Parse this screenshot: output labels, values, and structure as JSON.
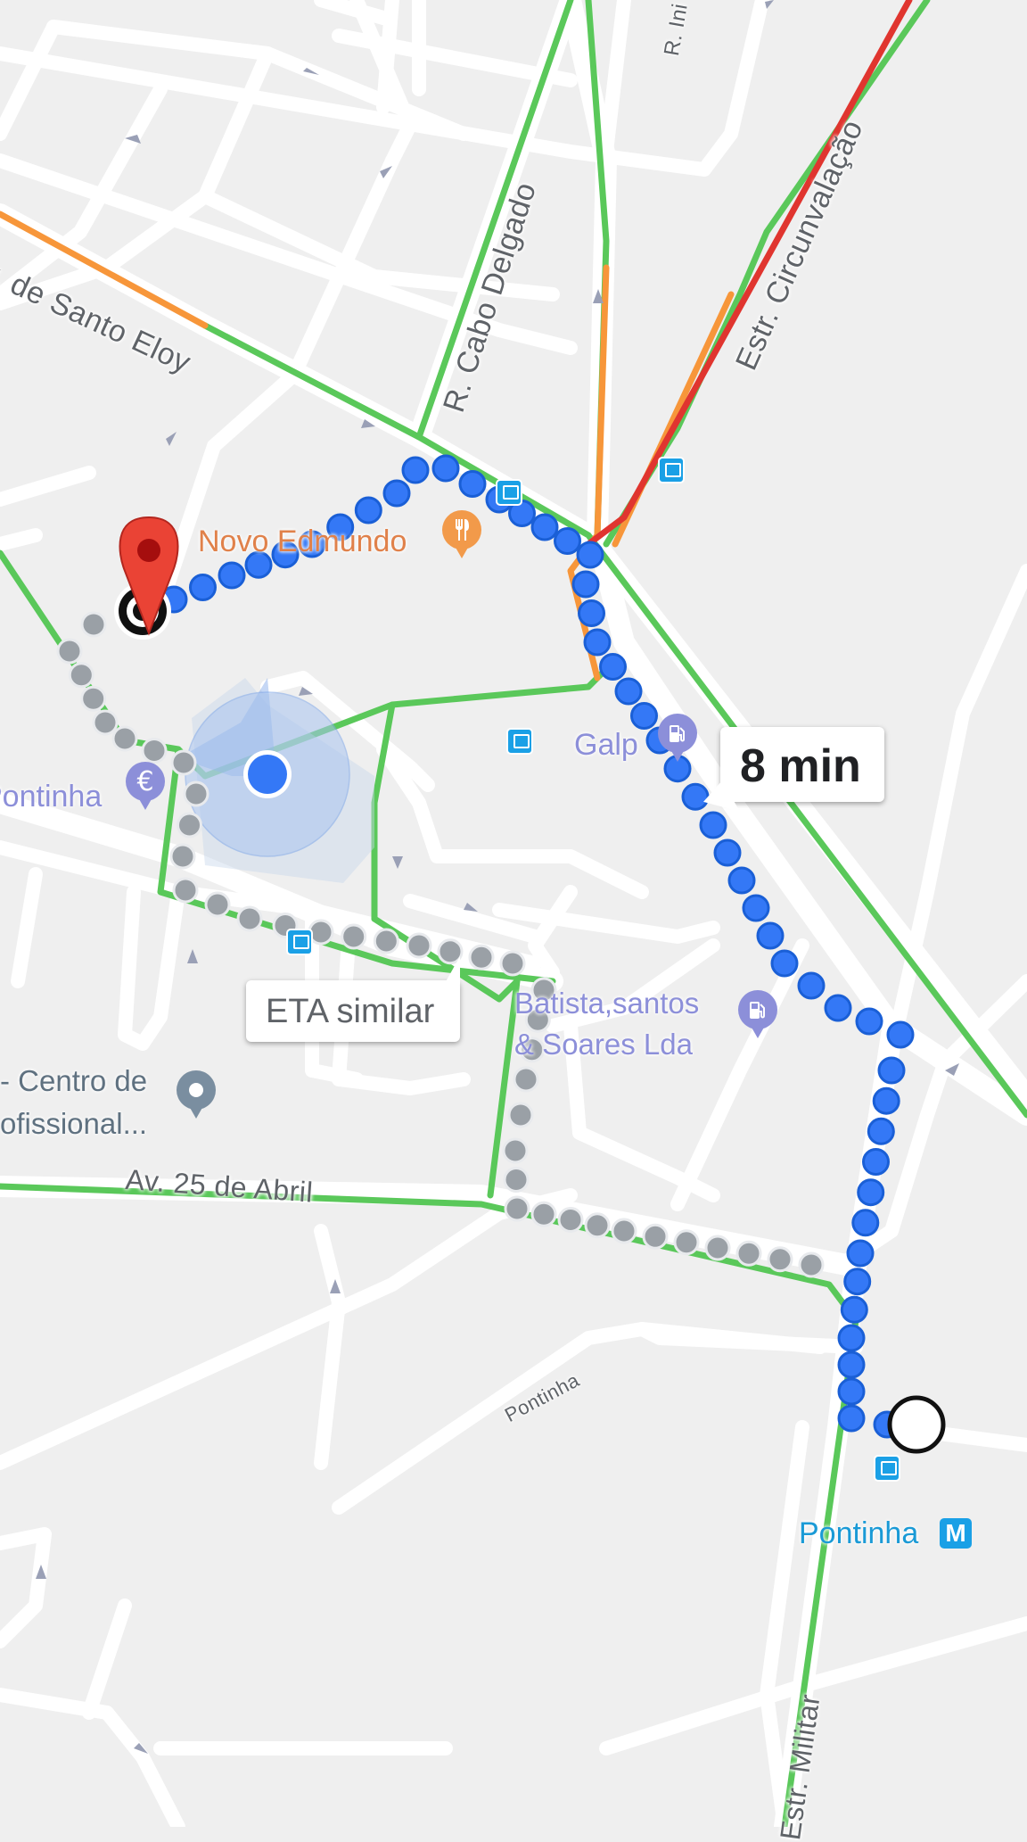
{
  "map": {
    "colors": {
      "background": "#efefef",
      "road": "#ffffff",
      "traffic_green": "#5ac85a",
      "traffic_orange": "#f7963a",
      "traffic_red": "#e0352f",
      "route_primary": "#3478f6",
      "route_alternative": "#9aa0a6",
      "food_poi": "#f29a4a",
      "service_poi": "#8c8fd9",
      "place_poi": "#7a8ea0",
      "transit": "#1aa0e6",
      "destination_pin": "#ea4335"
    },
    "road_labels": {
      "santo_eloy": "Av. de Santo Eloy",
      "cabo_delgado": "R. Cabo Delgado",
      "circunvalacao": "Estr. Circunvalação",
      "r_ini": "R. Ini",
      "av_25_abril": "Av. 25 de Abril",
      "pontinha_street": "Pontinha",
      "militar": "Estr. Militar"
    },
    "pois": {
      "novo_edmundo": "Novo Edmundo",
      "galp": "Galp",
      "pontinha_bank": "Pontinha",
      "batista": "Batista,santos\n& Soares Lda",
      "centro": "- Centro de\nofissional...",
      "pontinha_metro": "Pontinha",
      "metro_badge": "M"
    },
    "icons": {
      "restaurant": "restaurant-icon",
      "fuel": "fuel-icon",
      "bank": "euro-icon",
      "place": "place-pin-icon",
      "bus": "bus-stop-icon",
      "metro": "metro-icon",
      "destination": "destination-pin-icon",
      "location": "my-location-dot",
      "one_way": "one-way-arrow-icon"
    }
  },
  "route": {
    "primary_eta": "8 min",
    "alternative_eta": "ETA similar"
  }
}
